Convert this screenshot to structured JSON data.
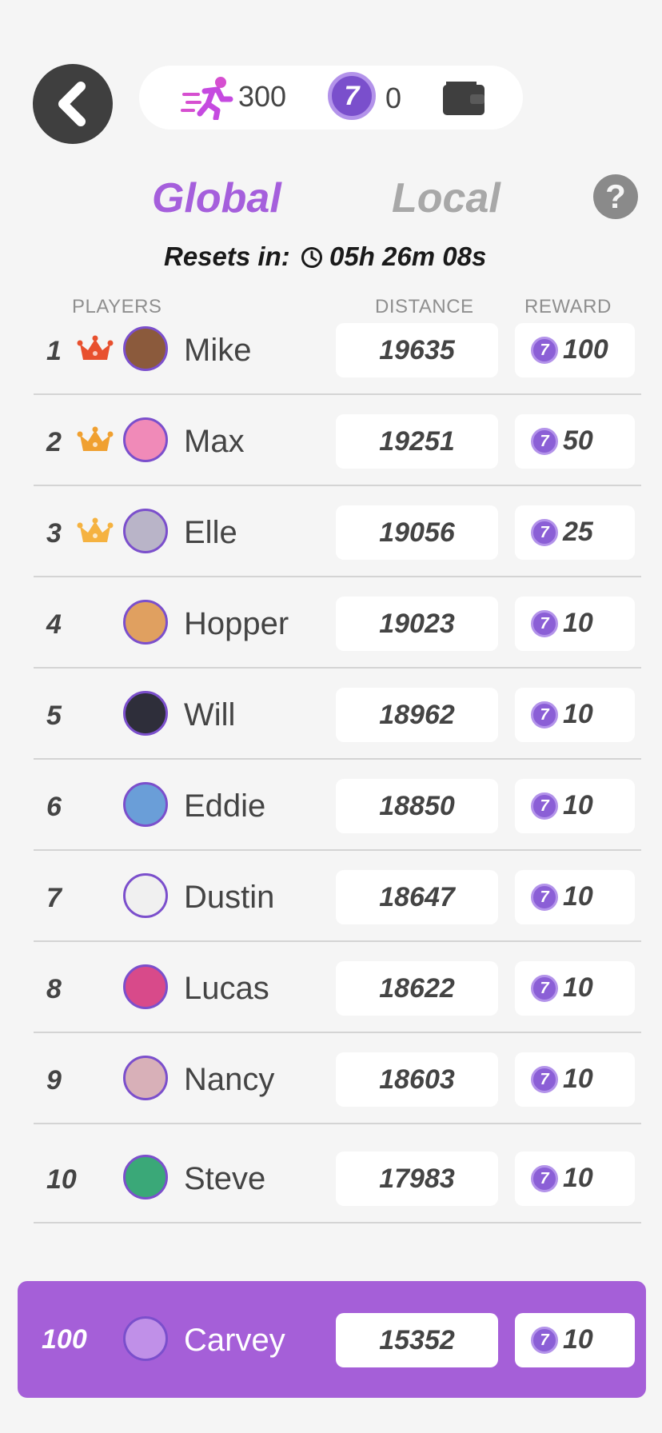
{
  "header": {
    "back_icon": "chevron-left-icon",
    "energy": "300",
    "coins": "0",
    "coin_symbol": "7",
    "wallet_icon": "wallet-icon"
  },
  "tabs": {
    "global": "Global",
    "local": "Local",
    "help": "?"
  },
  "resets": {
    "label": "Resets in:",
    "time": "05h 26m 08s"
  },
  "columns": {
    "players": "PLAYERS",
    "distance": "DISTANCE",
    "reward": "REWARD"
  },
  "leaderboard": [
    {
      "rank": "1",
      "name": "Mike",
      "distance": "19635",
      "reward": "100",
      "crown": "gold",
      "avatar_color": "#8b5a3c"
    },
    {
      "rank": "2",
      "name": "Max",
      "distance": "19251",
      "reward": "50",
      "crown": "silver",
      "avatar_color": "#f08ab8"
    },
    {
      "rank": "3",
      "name": "Elle",
      "distance": "19056",
      "reward": "25",
      "crown": "bronze",
      "avatar_color": "#b9b4c8"
    },
    {
      "rank": "4",
      "name": "Hopper",
      "distance": "19023",
      "reward": "10",
      "avatar_color": "#e0a060"
    },
    {
      "rank": "5",
      "name": "Will",
      "distance": "18962",
      "reward": "10",
      "avatar_color": "#2e2e3a"
    },
    {
      "rank": "6",
      "name": "Eddie",
      "distance": "18850",
      "reward": "10",
      "avatar_color": "#6a9ed8"
    },
    {
      "rank": "7",
      "name": "Dustin",
      "distance": "18647",
      "reward": "10",
      "avatar_color": "#f0f0f0"
    },
    {
      "rank": "8",
      "name": "Lucas",
      "distance": "18622",
      "reward": "10",
      "avatar_color": "#d84a8a"
    },
    {
      "rank": "9",
      "name": "Nancy",
      "distance": "18603",
      "reward": "10",
      "avatar_color": "#d8b0b8"
    },
    {
      "rank": "10",
      "name": "Steve",
      "distance": "17983",
      "reward": "10",
      "avatar_color": "#3aa878"
    }
  ],
  "me": {
    "rank": "100",
    "name": "Carvey",
    "distance": "15352",
    "reward": "10",
    "avatar_color": "#c090e8"
  },
  "colors": {
    "accent": "#a55fd8",
    "coin": "#7a4fcc",
    "inactive": "#a8a8a8"
  }
}
